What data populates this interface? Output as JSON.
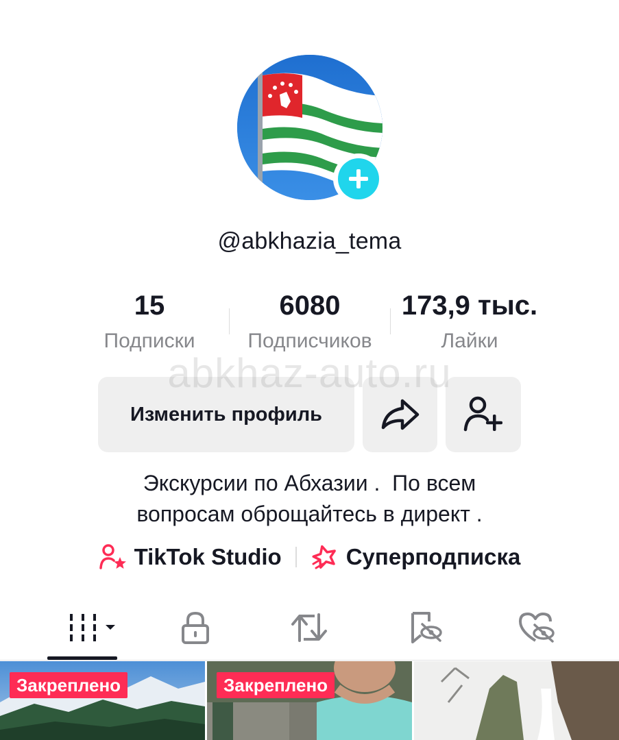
{
  "profile": {
    "username": "@abkhazia_tema",
    "stats": [
      {
        "value": "15",
        "label": "Подписки"
      },
      {
        "value": "6080",
        "label": "Подписчиков"
      },
      {
        "value": "173,9 тыс.",
        "label": "Лайки"
      }
    ],
    "watermark": "abkhaz-auto.ru",
    "edit_button_label": "Изменить профиль",
    "bio_lines": [
      "Экскурсии по Абхазии .  По всем",
      "вопросам оброщайтесь в директ ."
    ],
    "links": [
      {
        "label": "TikTok Studio",
        "icon": "studio-person-star-icon"
      },
      {
        "label": "Суперподписка",
        "icon": "super-subscription-icon"
      }
    ]
  },
  "tabs": [
    {
      "name": "videos",
      "icon": "grid-videos-icon",
      "active": true
    },
    {
      "name": "private",
      "icon": "lock-icon",
      "active": false
    },
    {
      "name": "reposts",
      "icon": "repost-icon",
      "active": false
    },
    {
      "name": "favorites",
      "icon": "bookmark-hidden-icon",
      "active": false
    },
    {
      "name": "liked",
      "icon": "heart-hidden-icon",
      "active": false
    }
  ],
  "videos": [
    {
      "pinned_label": "Закреплено"
    },
    {
      "pinned_label": "Закреплено"
    },
    {
      "pinned_label": ""
    }
  ],
  "colors": {
    "accent_cyan": "#20d5ec",
    "pinned_red": "#fe2c55",
    "text_primary": "#161823",
    "text_secondary": "#86878b",
    "button_bg": "#efefef"
  }
}
